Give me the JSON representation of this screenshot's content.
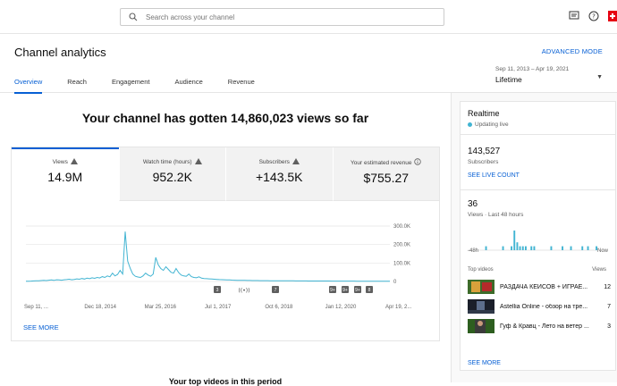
{
  "search": {
    "placeholder": "Search across your channel"
  },
  "header": {
    "title": "Channel analytics",
    "advanced_mode": "ADVANCED MODE",
    "tabs": [
      "Overview",
      "Reach",
      "Engagement",
      "Audience",
      "Revenue"
    ],
    "date_range": "Sep 11, 2013 – Apr 19, 2021",
    "date_label": "Lifetime"
  },
  "main": {
    "headline": "Your channel has gotten 14,860,023 views so far",
    "metrics": [
      {
        "label": "Views",
        "value": "14.9M"
      },
      {
        "label": "Watch time (hours)",
        "value": "952.2K"
      },
      {
        "label": "Subscribers",
        "value": "+143.5K"
      },
      {
        "label": "Your estimated revenue",
        "value": "$755.27"
      }
    ],
    "see_more": "SEE MORE",
    "bottom_title": "Your top videos in this period"
  },
  "chart_data": {
    "type": "line",
    "x_ticks": [
      "Sep 11, ...",
      "Dec 18, 2014",
      "Mar 25, 2016",
      "Jul 1, 2017",
      "Oct 6, 2018",
      "Jan 12, 2020",
      "Apr 19, 2..."
    ],
    "y_ticks": [
      "300.0K",
      "200.0K",
      "100.0K",
      "0"
    ],
    "ylim": [
      0,
      300000
    ],
    "markers": [
      "3",
      "((•))",
      "7",
      "9+",
      "9+",
      "9+",
      "8"
    ],
    "values": [
      1000,
      1500,
      2000,
      3000,
      3500,
      4000,
      5000,
      6000,
      5000,
      7000,
      8000,
      6000,
      9000,
      8000,
      7000,
      9000,
      10000,
      12000,
      9000,
      11000,
      14000,
      12000,
      16000,
      13000,
      18000,
      15000,
      20000,
      17000,
      22000,
      19000,
      26000,
      22000,
      30000,
      25000,
      45000,
      30000,
      38000,
      60000,
      40000,
      270000,
      110000,
      70000,
      40000,
      28000,
      24000,
      22000,
      30000,
      45000,
      35000,
      28000,
      40000,
      130000,
      90000,
      70000,
      60000,
      80000,
      65000,
      50000,
      45000,
      70000,
      48000,
      35000,
      30000,
      28000,
      40000,
      26000,
      22000,
      20000,
      25000,
      18000,
      16000,
      15000,
      14000,
      13000,
      12000,
      11000,
      10000,
      9500,
      9000,
      8500,
      8000,
      7500,
      7000,
      6500,
      6000,
      5800,
      5600,
      5400,
      5200,
      5000,
      4800,
      4600,
      4500,
      4400,
      4300,
      4200,
      4100,
      4000,
      3900,
      3800,
      3700,
      3600,
      3500,
      3400,
      3300,
      3200,
      3100,
      3000,
      2900,
      2800,
      2700,
      2600,
      2500,
      2500,
      2400,
      2400,
      2300,
      2300,
      2200,
      2200,
      2100,
      2100,
      2000,
      2000,
      1900,
      1900,
      1800,
      1800,
      1700,
      1700,
      1600,
      1600,
      1500,
      1500,
      1400,
      1400,
      1300,
      1300,
      1200,
      1200,
      1100,
      1100,
      1000,
      1000
    ],
    "color": "#41b4d2"
  },
  "realtime": {
    "title": "Realtime",
    "status": "Updating live",
    "subscribers": "143,527",
    "subscribers_label": "Subscribers",
    "see_live_count": "SEE LIVE COUNT",
    "views": "36",
    "views_label": "Views · Last 48 hours",
    "axis_left": "-48h",
    "axis_right": "Now",
    "top_videos_label": "Top videos",
    "views_col": "Views",
    "mini_values": [
      0,
      0,
      0,
      0,
      0,
      0,
      1,
      0,
      0,
      0,
      0,
      0,
      1,
      0,
      0,
      1,
      5,
      2,
      1,
      1,
      1,
      0,
      1,
      1,
      0,
      0,
      0,
      0,
      0,
      1,
      0,
      0,
      0,
      1,
      0,
      0,
      1,
      0,
      0,
      0,
      1,
      0,
      1,
      0,
      0,
      1,
      0,
      0
    ],
    "videos": [
      {
        "title": "РАЗДАЧА КЕЙСОВ + ИГРАЕ...",
        "views": "12"
      },
      {
        "title": "Astellia Online - обзор на тре...",
        "views": "7"
      },
      {
        "title": "Гуф & Кравц - Лето на ветер ...",
        "views": "3"
      }
    ],
    "see_more": "SEE MORE"
  },
  "colors": {
    "accent": "#065fd4",
    "chart": "#41b4d2"
  }
}
